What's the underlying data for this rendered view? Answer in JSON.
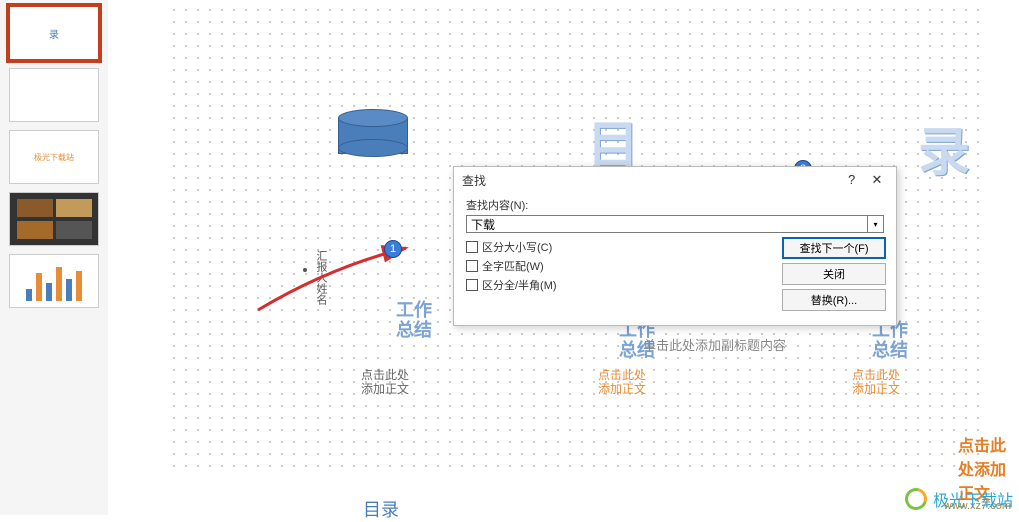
{
  "thumbs": {
    "t1_char": "录",
    "t3_line1": "极光下载站",
    "t4_line1": "img",
    "t5_chart": "chart"
  },
  "slide": {
    "char_mu": "目",
    "char_lu": "录",
    "report_label": "汇报人姓名",
    "work_title": "工作\n总结",
    "subtitle": "单击此处添加副标题内容",
    "add_body1": "点击此处\n添加正文",
    "add_body2": "点击此处\n添加正文",
    "add_body3": "点击此处\n添加正文",
    "add_body_right": "点击此处添加正文",
    "mulu": "目录"
  },
  "callouts": {
    "c1": "1",
    "c2": "2"
  },
  "dialog": {
    "title": "查找",
    "help": "?",
    "close": "✕",
    "content_label": "查找内容(N):",
    "content_value": "下载",
    "chk_case": "区分大小写(C)",
    "chk_whole": "全字匹配(W)",
    "chk_width": "区分全/半角(M)",
    "btn_next": "查找下一个(F)",
    "btn_close": "关闭",
    "btn_replace": "替换(R)..."
  },
  "watermark": {
    "text": "极光下载站",
    "url": "www.xz7.com"
  }
}
